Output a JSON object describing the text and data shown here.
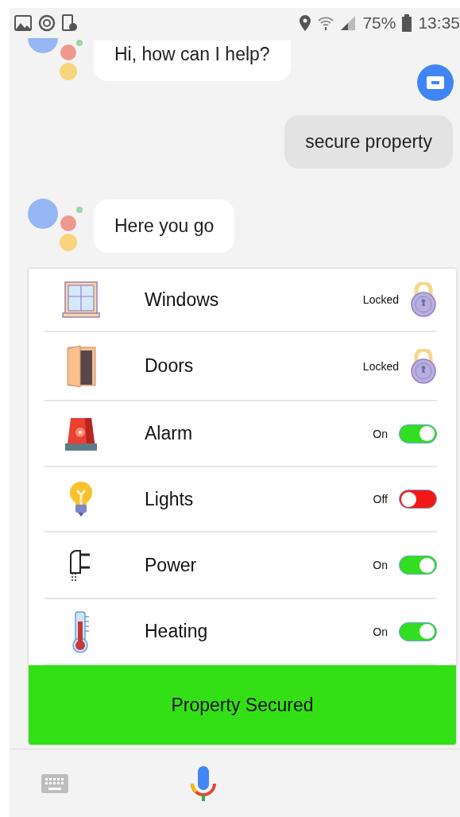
{
  "status_bar": {
    "battery": "75%",
    "time": "13:35"
  },
  "messages": [
    {
      "kind": "assistant",
      "text": "Hi, how can I help?"
    },
    {
      "kind": "user",
      "text": "secure property"
    },
    {
      "kind": "assistant",
      "text": "Here you go"
    }
  ],
  "devices": [
    {
      "kind": "lock",
      "name": "Windows",
      "status": "Locked",
      "locked": true
    },
    {
      "kind": "lock",
      "name": "Doors",
      "status": "Locked",
      "locked": true
    },
    {
      "kind": "toggle",
      "name": "Alarm",
      "status": "On",
      "on": true
    },
    {
      "kind": "toggle",
      "name": "Lights",
      "status": "Off",
      "on": false
    },
    {
      "kind": "toggle",
      "name": "Power",
      "status": "On",
      "on": true
    },
    {
      "kind": "toggle",
      "name": "Heating",
      "status": "On",
      "on": true
    }
  ],
  "banner": "Property Secured"
}
